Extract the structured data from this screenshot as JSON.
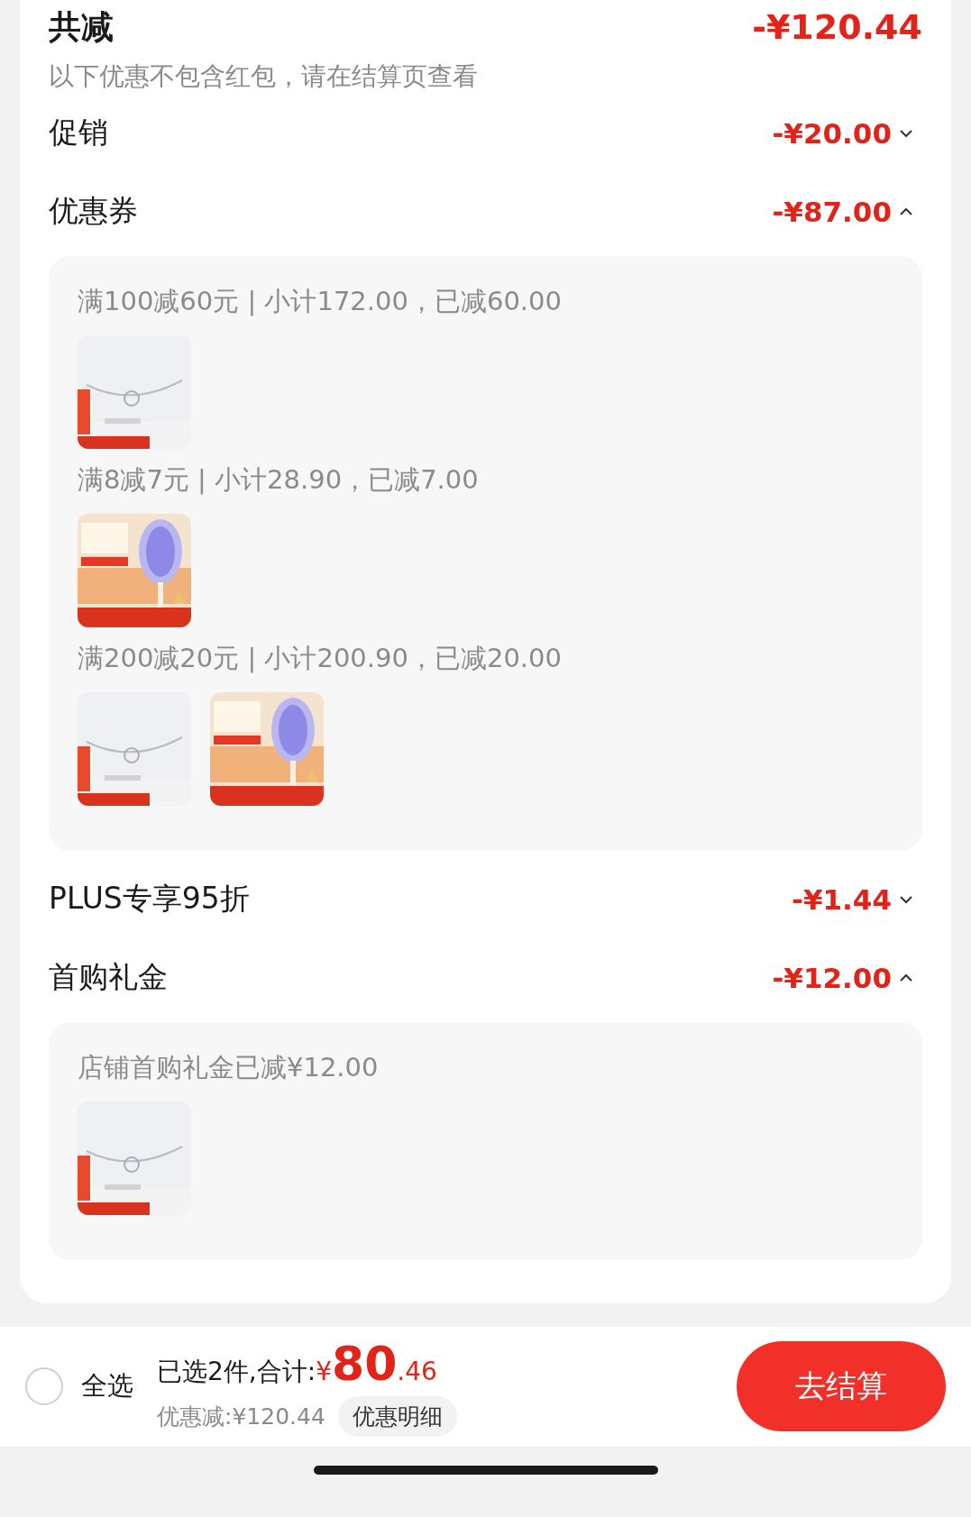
{
  "summary": {
    "title": "共减",
    "amount": "-¥120.44",
    "note": "以下优惠不包含红包，请在结算页查看"
  },
  "discounts": [
    {
      "label": "促销",
      "amount": "-¥20.00",
      "expanded": false
    },
    {
      "label": "优惠券",
      "amount": "-¥87.00",
      "expanded": true,
      "groups": [
        {
          "title": "满100减60元 | 小计172.00，已减60.00"
        },
        {
          "title": "满8减7元 | 小计28.90，已减7.00"
        },
        {
          "title": "满200减20元 | 小计200.90，已减20.00"
        }
      ]
    },
    {
      "label": "PLUS专享95折",
      "amount": "-¥1.44",
      "expanded": false
    },
    {
      "label": "首购礼金",
      "amount": "-¥12.00",
      "expanded": true,
      "groups": [
        {
          "title": "店铺首购礼金已减¥12.00"
        }
      ]
    }
  ],
  "bottom_bar": {
    "select_all": {
      "label": "全选",
      "selected": false
    },
    "selected_text": "已选2件,合计:",
    "currency": "¥",
    "price_integer": "80",
    "price_decimal": ".46",
    "saved": "优惠减:¥120.44",
    "detail_button": "优惠明细",
    "checkout_button": "去结算"
  }
}
